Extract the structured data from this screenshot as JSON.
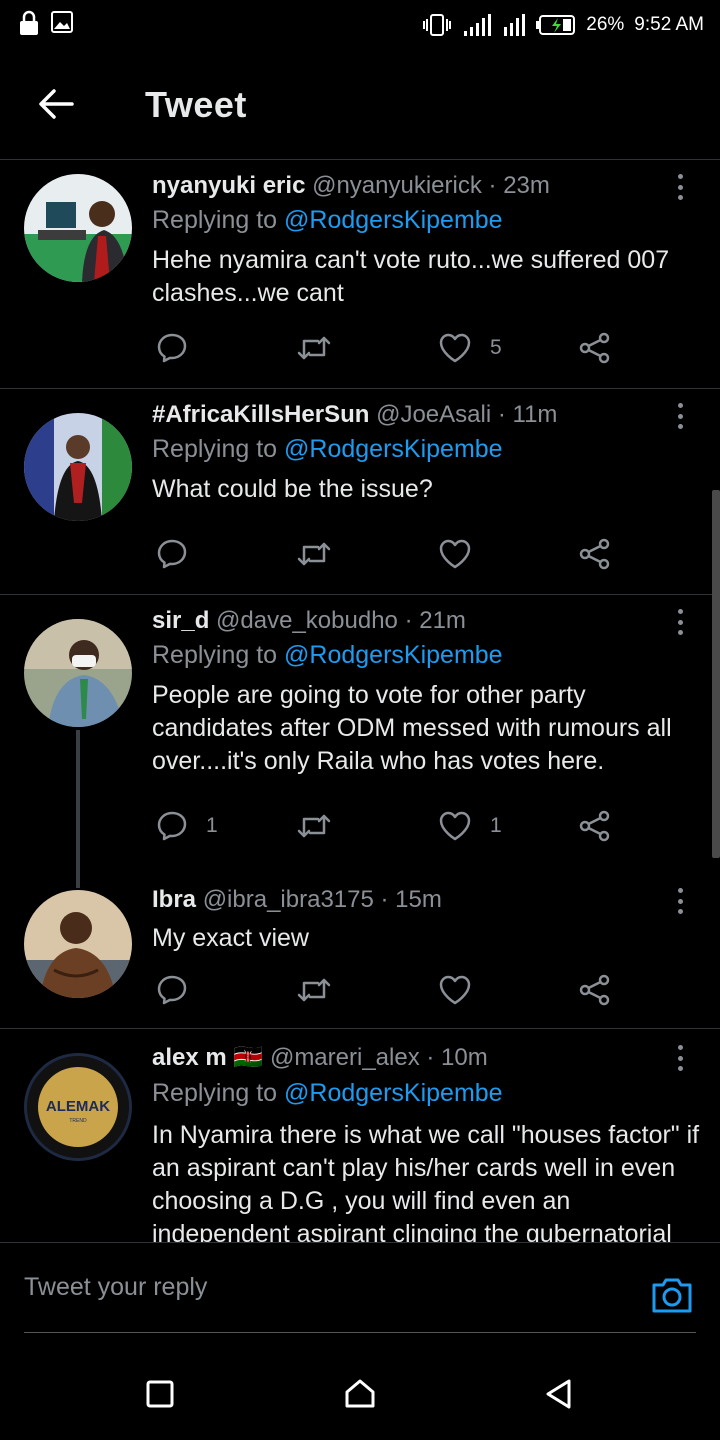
{
  "status_bar": {
    "battery": "26%",
    "time": "9:52 AM",
    "icons": [
      "lock-icon",
      "image-icon",
      "vibrate-icon",
      "signal-icon",
      "signal-icon",
      "battery-charging-icon"
    ]
  },
  "header": {
    "title": "Tweet",
    "back_icon": "arrow-left-icon"
  },
  "colors": {
    "background": "#000000",
    "link": "#1d9bf0",
    "muted": "#8b9096",
    "divider": "#2f3336"
  },
  "replying_label": "Replying to",
  "tweets": [
    {
      "name": "nyanyuki eric",
      "handle": "@nyanyukierick",
      "separator": "·",
      "time": "23m",
      "replying_to": "@RodgersKipembe",
      "text": "Hehe nyamira can't vote ruto...we suffered 007 clashes...we cant",
      "replies": "",
      "retweets": "",
      "likes": "5"
    },
    {
      "name": "#AfricaKillsHerSun",
      "handle": "@JoeAsali",
      "separator": "·",
      "time": "11m",
      "replying_to": "@RodgersKipembe",
      "text": "What could be the issue?",
      "replies": "",
      "retweets": "",
      "likes": ""
    },
    {
      "name": "sir_d",
      "handle": "@dave_kobudho",
      "separator": "·",
      "time": "21m",
      "replying_to": "@RodgersKipembe",
      "text": "People are going to vote for other party candidates after ODM messed with rumours all over....it's only Raila who has votes here.",
      "replies": "1",
      "retweets": "",
      "likes": "1"
    },
    {
      "name": "Ibra",
      "handle": "@ibra_ibra3175",
      "separator": "·",
      "time": "15m",
      "text": "My exact view",
      "replies": "",
      "retweets": "",
      "likes": ""
    },
    {
      "name": "alex m",
      "flag": "🇰🇪",
      "handle": "@mareri_alex",
      "separator": "·",
      "time": "10m",
      "replying_to": "@RodgersKipembe",
      "text": "In Nyamira there is what we call \"houses factor\" if an aspirant can't play his/her cards well in even choosing a D.G , you will find even an independent aspirant clinging the gubernatorial",
      "avatar_text": "ALEMAK",
      "avatar_subtext": "TREND"
    }
  ],
  "compose": {
    "placeholder": "Tweet your reply",
    "camera_icon": "camera-icon"
  },
  "nav": {
    "icons": [
      "recents-icon",
      "home-icon",
      "back-triangle-icon"
    ]
  }
}
